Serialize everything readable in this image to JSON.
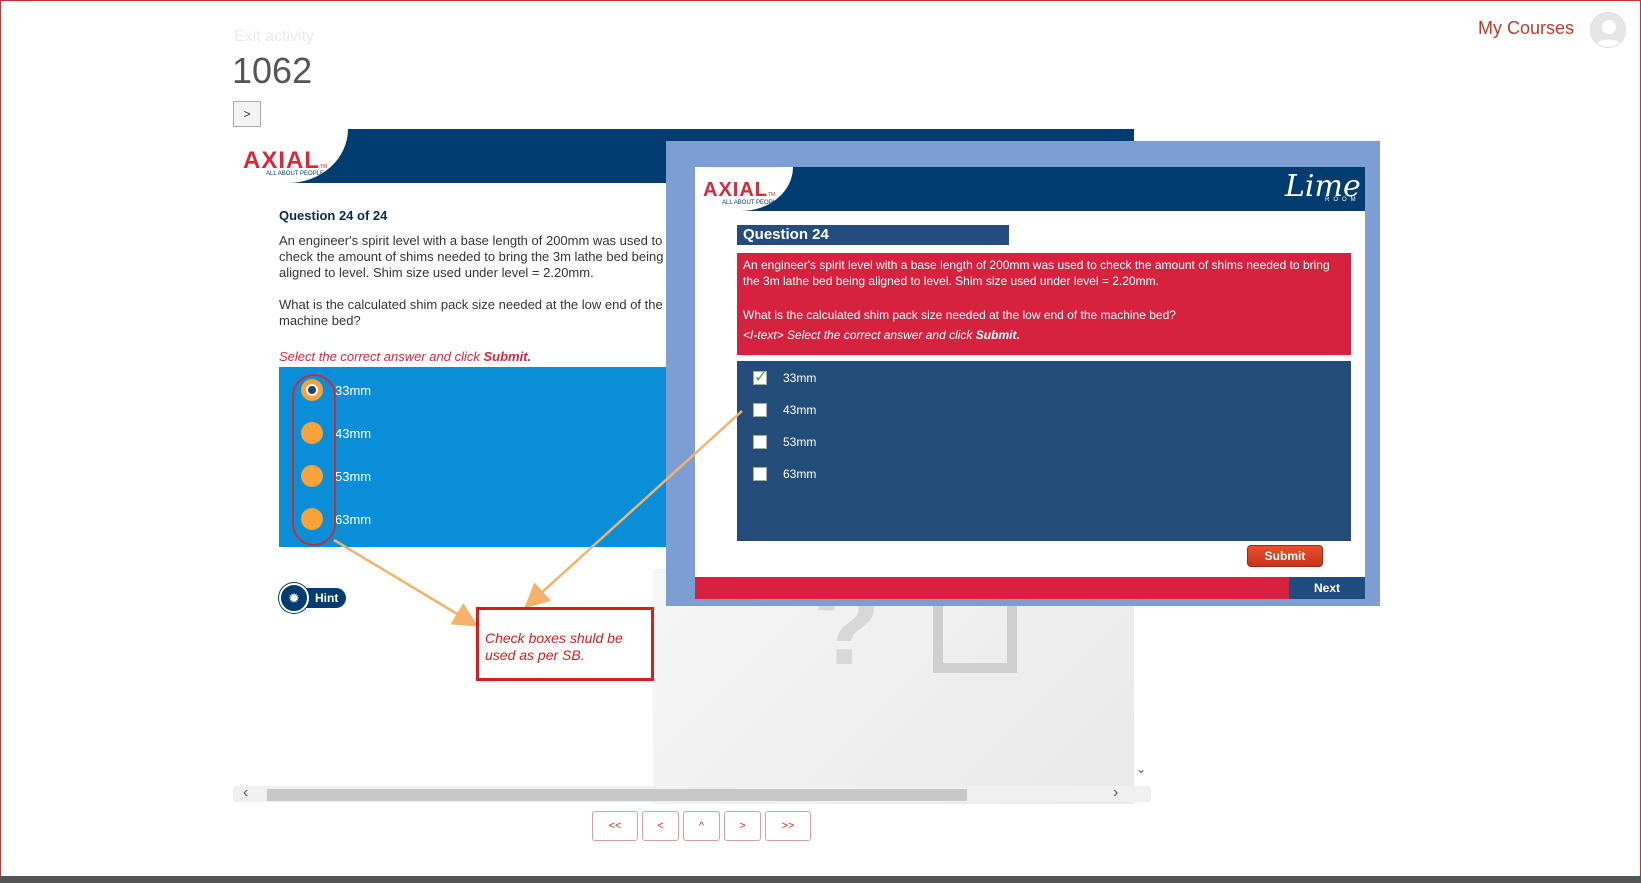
{
  "header": {
    "my_courses": "My Courses",
    "exit_activity": "Exit activity",
    "title": "1062",
    "toggle": ">"
  },
  "course": {
    "logo_text": "AXIAL",
    "logo_tm": "TM",
    "logo_sub": "ALL ABOUT PEOPLE",
    "question_heading": "Question 24 of 24",
    "question_text_1": "An engineer's spirit level with a base length of 200mm was used to check the amount of shims needed to bring the 3m lathe bed being aligned to level. Shim size used under level = 2.20mm.",
    "question_text_2": "What is the calculated shim pack size needed at the low end of the machine bed?",
    "instruction": "Select the correct answer and click",
    "instruction_bold": "Submit.",
    "options": [
      "33mm",
      "43mm",
      "53mm",
      "63mm"
    ],
    "selected_index": 0,
    "hint_label": "Hint"
  },
  "nav": {
    "first": "<<",
    "prev": "<",
    "up": "^",
    "next": ">",
    "last": ">>"
  },
  "overlay": {
    "logo_text": "AXIAL",
    "logo_tm": "TM",
    "logo_sub": "ALL ABOUT PEOPLE",
    "brand": "Lime",
    "brand_sub": "ROOM",
    "question_title": "Question 24",
    "question_text_1": "An engineer's spirit level with a base length of 200mm was used to check the amount of shims needed to bring the 3m lathe bed being aligned to level. Shim size used under level = 2.20mm.",
    "question_text_2": "What is the calculated shim pack size needed at the low end of the machine bed?",
    "instruction_prefix": "<I-text> Select the correct answer and click",
    "instruction_bold": "Submit.",
    "options": [
      "33mm",
      "43mm",
      "53mm",
      "63mm"
    ],
    "checked_index": 0,
    "submit": "Submit",
    "next": "Next"
  },
  "annotation": {
    "note": "Check boxes shuld be used as per SB."
  },
  "colors": {
    "brand_navy": "#003c6f",
    "brand_red": "#d6223f",
    "answer_blue": "#0a8ed8",
    "radio_orange": "#f7a23a",
    "annotation_red": "#d91c1c",
    "arrow_orange": "#f5b26b"
  }
}
